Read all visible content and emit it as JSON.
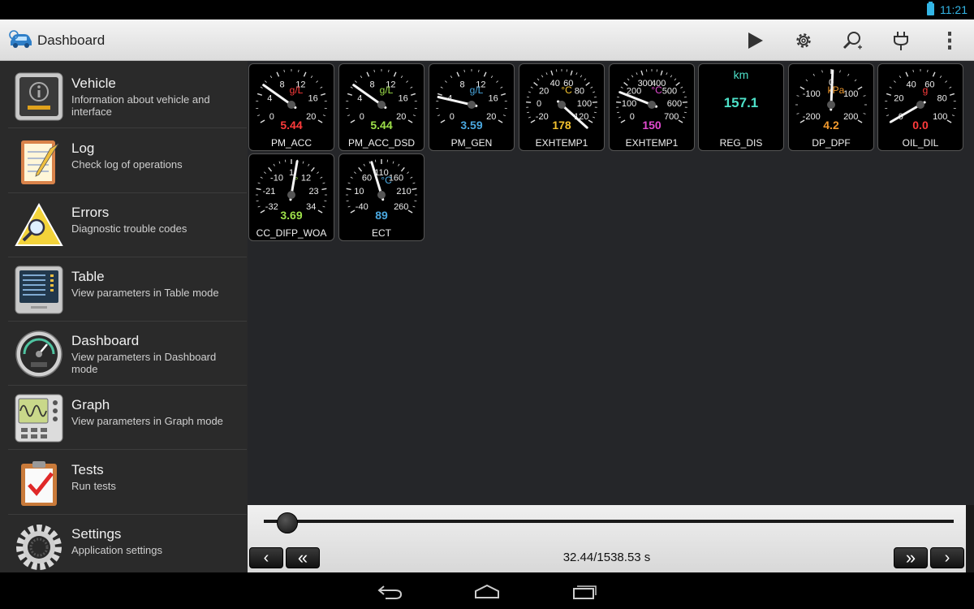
{
  "status_bar": {
    "time": "11:21",
    "battery_icon": "battery-icon"
  },
  "action_bar": {
    "title": "Dashboard",
    "actions": [
      "play-icon",
      "settings-gear-icon",
      "search-icon",
      "plug-connect-icon",
      "overflow-menu-icon"
    ]
  },
  "sidebar": {
    "items": [
      {
        "title": "Vehicle",
        "subtitle": "Information about vehicle and interface",
        "icon": "vehicle-info-icon"
      },
      {
        "title": "Log",
        "subtitle": "Check log of operations",
        "icon": "log-notepad-icon"
      },
      {
        "title": "Errors",
        "subtitle": "Diagnostic trouble codes",
        "icon": "warning-magnifier-icon"
      },
      {
        "title": "Table",
        "subtitle": "View parameters in Table mode",
        "icon": "table-icon"
      },
      {
        "title": "Dashboard",
        "subtitle": "View parameters in Dashboard mode",
        "icon": "dashboard-gauge-icon"
      },
      {
        "title": "Graph",
        "subtitle": "View parameters in Graph mode",
        "icon": "graph-oscilloscope-icon"
      },
      {
        "title": "Tests",
        "subtitle": "Run tests",
        "icon": "clipboard-check-icon"
      },
      {
        "title": "Settings",
        "subtitle": "Application settings",
        "icon": "gear-icon"
      }
    ]
  },
  "gauges": [
    {
      "name": "PM_ACC",
      "unit": "g/L",
      "unit_color": "#ff3b3b",
      "value": "5.44",
      "value_color": "#ff3b3b",
      "ticks": [
        "0",
        "4",
        "8",
        "12",
        "16",
        "20"
      ],
      "needle": 5.44,
      "min": 0,
      "max": 20
    },
    {
      "name": "PM_ACC_DSD",
      "unit": "g/L",
      "unit_color": "#9ee04a",
      "value": "5.44",
      "value_color": "#9ee04a",
      "ticks": [
        "0",
        "4",
        "8",
        "12",
        "16",
        "20"
      ],
      "needle": 5.44,
      "min": 0,
      "max": 20
    },
    {
      "name": "PM_GEN",
      "unit": "g/L",
      "unit_color": "#4aa8e0",
      "value": "3.59",
      "value_color": "#4aa8e0",
      "ticks": [
        "0",
        "4",
        "8",
        "12",
        "16",
        "20"
      ],
      "needle": 3.59,
      "min": 0,
      "max": 20
    },
    {
      "name": "EXHTEMP1",
      "unit": "°C",
      "unit_color": "#f2c12e",
      "value": "178",
      "value_color": "#f2c12e",
      "ticks": [
        "-20",
        "0",
        "20",
        "40",
        "60",
        "80",
        "100",
        "120"
      ],
      "needle": 178,
      "min": -20,
      "max": 120
    },
    {
      "name": "EXHTEMP1",
      "unit": "°C",
      "unit_color": "#e24ad0",
      "value": "150",
      "value_color": "#e24ad0",
      "ticks": [
        "0",
        "100",
        "200",
        "300",
        "400",
        "500",
        "600",
        "700"
      ],
      "needle": 150,
      "min": 0,
      "max": 700
    },
    {
      "name": "REG_DIS",
      "kind": "digital",
      "unit": "km",
      "unit_color": "#4de0c8",
      "value": "157.1",
      "value_color": "#4de0c8"
    },
    {
      "name": "DP_DPF",
      "unit": "kPa",
      "unit_color": "#f29a2e",
      "value": "4.2",
      "value_color": "#f29a2e",
      "ticks": [
        "-200",
        "-100",
        "0",
        "100",
        "200"
      ],
      "needle": 4.2,
      "min": -200,
      "max": 200
    },
    {
      "name": "OIL_DIL",
      "unit": "g",
      "unit_color": "#ff3b3b",
      "value": "0.0",
      "value_color": "#ff3b3b",
      "ticks": [
        "0",
        "20",
        "40",
        "60",
        "80",
        "100"
      ],
      "needle": 0,
      "min": 0,
      "max": 100
    },
    {
      "name": "CC_DIFP_WOA",
      "unit": "°",
      "unit_color": "#9ee04a",
      "value": "3.69",
      "value_color": "#9ee04a",
      "ticks": [
        "-32",
        "-21",
        "-10",
        "1",
        "12",
        "23",
        "34"
      ],
      "needle": 3.69,
      "min": -32,
      "max": 34
    },
    {
      "name": "ECT",
      "unit": "°C",
      "unit_color": "#4aa8e0",
      "value": "89",
      "value_color": "#4aa8e0",
      "ticks": [
        "-40",
        "10",
        "60",
        "110",
        "160",
        "210",
        "260"
      ],
      "needle": 89,
      "min": -40,
      "max": 260
    }
  ],
  "playback": {
    "time": "32.44/1538.53 s",
    "position": 32.44,
    "duration": 1538.53,
    "buttons": {
      "step_back": "‹",
      "rewind": "«",
      "fast_forward": "»",
      "step_forward": "›"
    }
  },
  "nav_bar": [
    "back-icon",
    "home-icon",
    "recent-apps-icon"
  ]
}
